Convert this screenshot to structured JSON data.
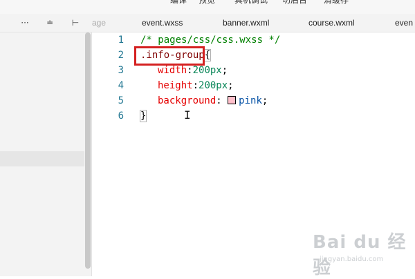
{
  "top_menu": {
    "items": [
      "编译",
      "预览",
      "真机调试",
      "切后台",
      "清缓存"
    ]
  },
  "sidebar_tools": {
    "more_label": "···",
    "collapse_label": "≐",
    "toggle_label": "⊢"
  },
  "tabs": [
    {
      "label": "age",
      "faded": true
    },
    {
      "label": "event.wxss"
    },
    {
      "label": "banner.wxml"
    },
    {
      "label": "course.wxml"
    },
    {
      "label": "even"
    }
  ],
  "editor": {
    "line_numbers": [
      "1",
      "2",
      "3",
      "4",
      "5",
      "6"
    ],
    "lines": {
      "l1": {
        "comment": "/* pages/css/css.wxss */"
      },
      "l2": {
        "selector": ".info-group",
        "brace": "{"
      },
      "l3": {
        "prop": "width",
        "colon": ":",
        "num": "200px",
        "semi": ";"
      },
      "l4": {
        "prop": "height",
        "colon": ":",
        "num": "200px",
        "semi": ";"
      },
      "l5": {
        "prop": "background",
        "colon": ": ",
        "val": "pink",
        "semi": ";"
      },
      "l6": {
        "brace": "}"
      }
    },
    "swatch_color": "#ffc0cb"
  },
  "cursor_glyph": "I",
  "watermark": {
    "main": "Bai du 经验",
    "sub": "jingyan.baidu.com"
  }
}
